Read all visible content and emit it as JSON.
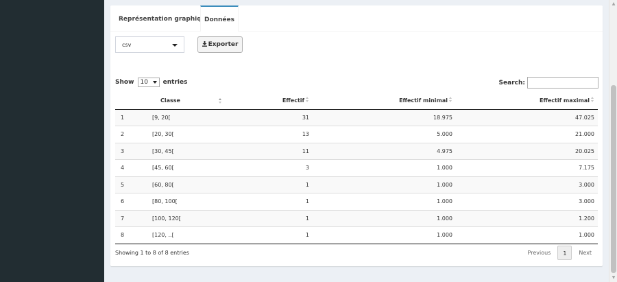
{
  "tabs": [
    {
      "label": "Représentation graphique"
    },
    {
      "label": "Données"
    }
  ],
  "format_select": {
    "value": "csv"
  },
  "export_button": {
    "label": "Exporter",
    "icon": "download-icon"
  },
  "length_control": {
    "prefix": "Show",
    "value": "10",
    "suffix": "entries"
  },
  "search": {
    "label": "Search:",
    "value": ""
  },
  "table": {
    "headers": [
      "",
      "Classe",
      "Effectif",
      "Effectif minimal",
      "Effectif maximal"
    ],
    "rows": [
      [
        "1",
        "[9, 20[",
        "31",
        "18.975",
        "47.025"
      ],
      [
        "2",
        "[20, 30[",
        "13",
        "5.000",
        "21.000"
      ],
      [
        "3",
        "[30, 45[",
        "11",
        "4.975",
        "20.025"
      ],
      [
        "4",
        "[45, 60[",
        "3",
        "1.000",
        "7.175"
      ],
      [
        "5",
        "[60, 80[",
        "1",
        "1.000",
        "3.000"
      ],
      [
        "6",
        "[80, 100[",
        "1",
        "1.000",
        "3.000"
      ],
      [
        "7",
        "[100, 120[",
        "1",
        "1.000",
        "1.200"
      ],
      [
        "8",
        "[120, ..[",
        "1",
        "1.000",
        "1.000"
      ]
    ]
  },
  "info": "Showing 1 to 8 of 8 entries",
  "pagination": {
    "previous": "Previous",
    "current": "1",
    "next": "Next"
  },
  "colors": {
    "sidebar": "#222d32",
    "tab_active_border": "#3c8dbc",
    "content_bg": "#ecf0f5"
  }
}
